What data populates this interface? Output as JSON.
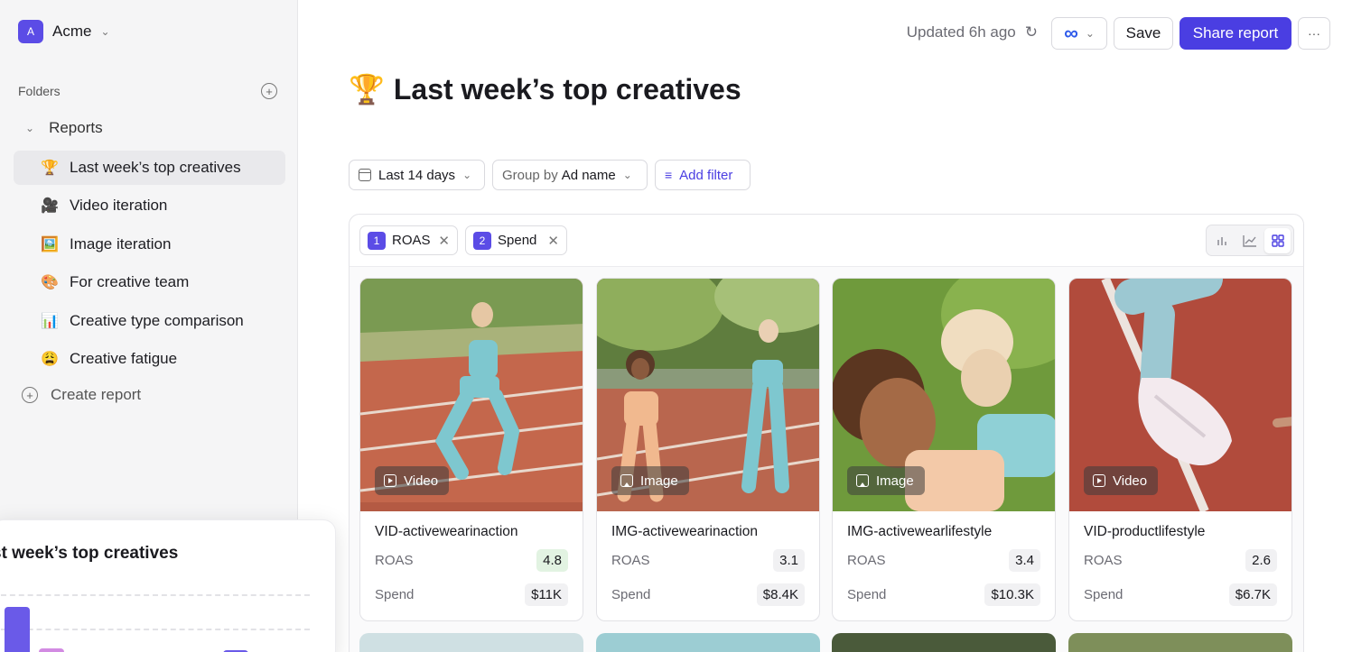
{
  "workspace": {
    "initial": "A",
    "name": "Acme"
  },
  "sidebar": {
    "folders_label": "Folders",
    "reports_label": "Reports",
    "items": [
      {
        "emoji": "🏆",
        "label": "Last week’s top creatives",
        "active": true
      },
      {
        "emoji": "🎥",
        "label": "Video iteration"
      },
      {
        "emoji": "🖼️",
        "label": "Image iteration"
      },
      {
        "emoji": "🎨",
        "label": "For creative team"
      },
      {
        "emoji": "📊",
        "label": "Creative type comparison"
      },
      {
        "emoji": "😩",
        "label": "Creative fatigue"
      }
    ],
    "create_report": "Create report"
  },
  "floating_card": {
    "title": "st week’s top creatives"
  },
  "topbar": {
    "updated": "Updated 6h ago",
    "save": "Save",
    "share": "Share report",
    "more": "···"
  },
  "page": {
    "emoji": "🏆",
    "title": "Last week’s top creatives"
  },
  "filters": {
    "date": "Last 14 days",
    "group_prefix": "Group by",
    "group_value": "Ad name",
    "add_filter": "Add filter"
  },
  "metrics": [
    {
      "num": "1",
      "label": "ROAS"
    },
    {
      "num": "2",
      "label": "Spend"
    }
  ],
  "cards": [
    {
      "type": "Video",
      "name": "VID-activewearinaction",
      "roas_label": "ROAS",
      "roas": "4.8",
      "spend_label": "Spend",
      "spend": "$11K"
    },
    {
      "type": "Image",
      "name": "IMG-activewearinaction",
      "roas_label": "ROAS",
      "roas": "3.1",
      "spend_label": "Spend",
      "spend": "$8.4K"
    },
    {
      "type": "Image",
      "name": "IMG-activewearlifestyle",
      "roas_label": "ROAS",
      "roas": "3.4",
      "spend_label": "Spend",
      "spend": "$10.3K"
    },
    {
      "type": "Video",
      "name": "VID-productlifestyle",
      "roas_label": "ROAS",
      "roas": "2.6",
      "spend_label": "Spend",
      "spend": "$6.7K"
    }
  ],
  "colors": {
    "accent": "#4a3ee2",
    "highlight_green": "#e2f3e2"
  }
}
